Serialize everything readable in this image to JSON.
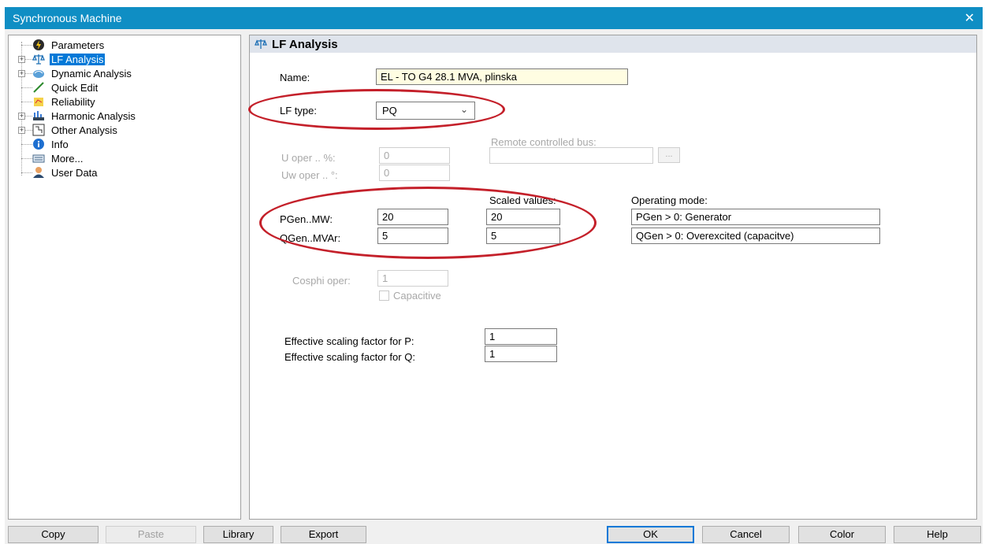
{
  "window": {
    "title": "Synchronous Machine",
    "close_glyph": "✕"
  },
  "tree": {
    "items": [
      {
        "label": "Parameters",
        "icon": "lightning-gear-icon"
      },
      {
        "label": "LF Analysis",
        "icon": "scales-icon",
        "selected": true
      },
      {
        "label": "Dynamic Analysis",
        "icon": "dynamic-icon"
      },
      {
        "label": "Quick Edit",
        "icon": "pencil-icon"
      },
      {
        "label": "Reliability",
        "icon": "reliability-icon"
      },
      {
        "label": "Harmonic Analysis",
        "icon": "harmonic-icon"
      },
      {
        "label": "Other Analysis",
        "icon": "other-analysis-icon"
      },
      {
        "label": "Info",
        "icon": "info-icon"
      },
      {
        "label": "More...",
        "icon": "keyboard-icon"
      },
      {
        "label": "User Data",
        "icon": "user-icon"
      }
    ]
  },
  "panel": {
    "header": "LF Analysis",
    "name_label": "Name:",
    "name_value": "EL - TO G4 28.1 MVA, plinska",
    "lf_type_label": "LF type:",
    "lf_type_value": "PQ",
    "remote_bus_label": "Remote controlled bus:",
    "remote_bus_value": "",
    "remote_bus_button": "...",
    "u_oper_label": "U oper .. %:",
    "u_oper_value": "0",
    "uw_oper_label": "Uw oper .. °:",
    "uw_oper_value": "0",
    "scaled_values_label": "Scaled values:",
    "operating_mode_label": "Operating mode:",
    "pgen_label": "PGen..MW:",
    "pgen_value": "20",
    "pgen_scaled": "20",
    "pgen_mode": "PGen > 0: Generator",
    "qgen_label": "QGen..MVAr:",
    "qgen_value": "5",
    "qgen_scaled": "5",
    "qgen_mode": "QGen > 0: Overexcited (capacitve)",
    "cosphi_label": "Cosphi oper:",
    "cosphi_value": "1",
    "capacitive_label": "Capacitive",
    "eff_p_label": "Effective scaling factor for P:",
    "eff_p_value": "1",
    "eff_q_label": "Effective scaling factor for Q:",
    "eff_q_value": "1"
  },
  "buttons": {
    "copy": "Copy",
    "paste": "Paste",
    "library": "Library",
    "export": "Export",
    "ok": "OK",
    "cancel": "Cancel",
    "color": "Color",
    "help": "Help"
  },
  "colors": {
    "titlebar": "#0f8ec4",
    "selection": "#0078d7",
    "highlight_ellipse": "#c4202a",
    "name_field_bg": "#fffde2"
  }
}
